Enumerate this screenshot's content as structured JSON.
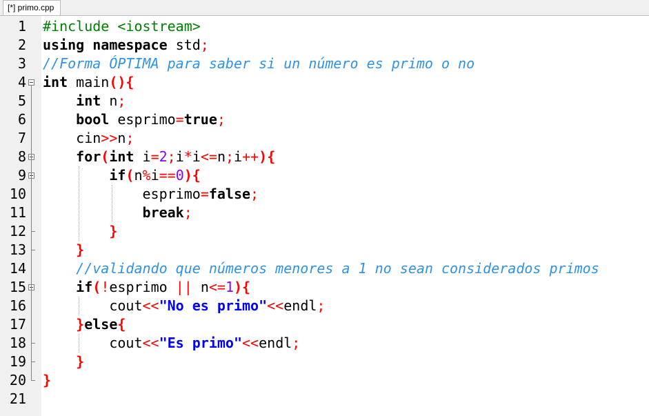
{
  "tab": {
    "title": "[*] primo.cpp"
  },
  "line_numbers": [
    "1",
    "2",
    "3",
    "4",
    "5",
    "6",
    "7",
    "8",
    "9",
    "10",
    "11",
    "12",
    "13",
    "14",
    "15",
    "16",
    "17",
    "18",
    "19",
    "20",
    "21"
  ],
  "code_lines": [
    [
      {
        "t": "#include <iostream>",
        "c": "pp"
      }
    ],
    [
      {
        "t": "using namespace",
        "c": "k"
      },
      {
        "t": " std",
        "c": ""
      },
      {
        "t": ";",
        "c": "op"
      }
    ],
    [
      {
        "t": "//Forma ÓPTIMA para saber si un número es primo o no",
        "c": "cm"
      }
    ],
    [
      {
        "t": "int",
        "c": "k"
      },
      {
        "t": " main",
        "c": ""
      },
      {
        "t": "(){",
        "c": "br"
      }
    ],
    [
      {
        "t": "    ",
        "c": ""
      },
      {
        "t": "int",
        "c": "k"
      },
      {
        "t": " n",
        "c": ""
      },
      {
        "t": ";",
        "c": "op"
      }
    ],
    [
      {
        "t": "    ",
        "c": ""
      },
      {
        "t": "bool",
        "c": "k"
      },
      {
        "t": " esprimo",
        "c": ""
      },
      {
        "t": "=",
        "c": "op"
      },
      {
        "t": "true",
        "c": "k"
      },
      {
        "t": ";",
        "c": "op"
      }
    ],
    [
      {
        "t": "    cin",
        "c": ""
      },
      {
        "t": ">>",
        "c": "op"
      },
      {
        "t": "n",
        "c": ""
      },
      {
        "t": ";",
        "c": "op"
      }
    ],
    [
      {
        "t": "    ",
        "c": ""
      },
      {
        "t": "for",
        "c": "k"
      },
      {
        "t": "(",
        "c": "br"
      },
      {
        "t": "int",
        "c": "k"
      },
      {
        "t": " i",
        "c": ""
      },
      {
        "t": "=",
        "c": "op"
      },
      {
        "t": "2",
        "c": "num"
      },
      {
        "t": ";",
        "c": "op"
      },
      {
        "t": "i",
        "c": ""
      },
      {
        "t": "*",
        "c": "op"
      },
      {
        "t": "i",
        "c": ""
      },
      {
        "t": "<=",
        "c": "op"
      },
      {
        "t": "n",
        "c": ""
      },
      {
        "t": ";",
        "c": "op"
      },
      {
        "t": "i",
        "c": ""
      },
      {
        "t": "++",
        "c": "op"
      },
      {
        "t": "){",
        "c": "br"
      }
    ],
    [
      {
        "t": "        ",
        "c": ""
      },
      {
        "t": "if",
        "c": "k"
      },
      {
        "t": "(",
        "c": "br"
      },
      {
        "t": "n",
        "c": ""
      },
      {
        "t": "%",
        "c": "op"
      },
      {
        "t": "i",
        "c": ""
      },
      {
        "t": "==",
        "c": "op"
      },
      {
        "t": "0",
        "c": "num"
      },
      {
        "t": "){",
        "c": "br"
      }
    ],
    [
      {
        "t": "            esprimo",
        "c": ""
      },
      {
        "t": "=",
        "c": "op"
      },
      {
        "t": "false",
        "c": "k"
      },
      {
        "t": ";",
        "c": "op"
      }
    ],
    [
      {
        "t": "            ",
        "c": ""
      },
      {
        "t": "break",
        "c": "k"
      },
      {
        "t": ";",
        "c": "op"
      }
    ],
    [
      {
        "t": "        ",
        "c": ""
      },
      {
        "t": "}",
        "c": "br"
      }
    ],
    [
      {
        "t": "    ",
        "c": ""
      },
      {
        "t": "}",
        "c": "br"
      }
    ],
    [
      {
        "t": "    ",
        "c": ""
      },
      {
        "t": "//validando que números menores a 1 no sean considerados primos",
        "c": "cm"
      }
    ],
    [
      {
        "t": "    ",
        "c": ""
      },
      {
        "t": "if",
        "c": "k"
      },
      {
        "t": "(",
        "c": "br"
      },
      {
        "t": "!",
        "c": "op"
      },
      {
        "t": "esprimo ",
        "c": ""
      },
      {
        "t": "||",
        "c": "op"
      },
      {
        "t": " n",
        "c": ""
      },
      {
        "t": "<=",
        "c": "op"
      },
      {
        "t": "1",
        "c": "num"
      },
      {
        "t": "){",
        "c": "br"
      }
    ],
    [
      {
        "t": "        cout",
        "c": ""
      },
      {
        "t": "<<",
        "c": "op"
      },
      {
        "t": "\"No es primo\"",
        "c": "str"
      },
      {
        "t": "<<",
        "c": "op"
      },
      {
        "t": "endl",
        "c": ""
      },
      {
        "t": ";",
        "c": "op"
      }
    ],
    [
      {
        "t": "    ",
        "c": ""
      },
      {
        "t": "}",
        "c": "br"
      },
      {
        "t": "else",
        "c": "k"
      },
      {
        "t": "{",
        "c": "br"
      }
    ],
    [
      {
        "t": "        cout",
        "c": ""
      },
      {
        "t": "<<",
        "c": "op"
      },
      {
        "t": "\"Es primo\"",
        "c": "str"
      },
      {
        "t": "<<",
        "c": "op"
      },
      {
        "t": "endl",
        "c": ""
      },
      {
        "t": ";",
        "c": "op"
      }
    ],
    [
      {
        "t": "    ",
        "c": ""
      },
      {
        "t": "}",
        "c": "br"
      }
    ],
    [
      {
        "t": "}",
        "c": "br"
      }
    ],
    []
  ]
}
